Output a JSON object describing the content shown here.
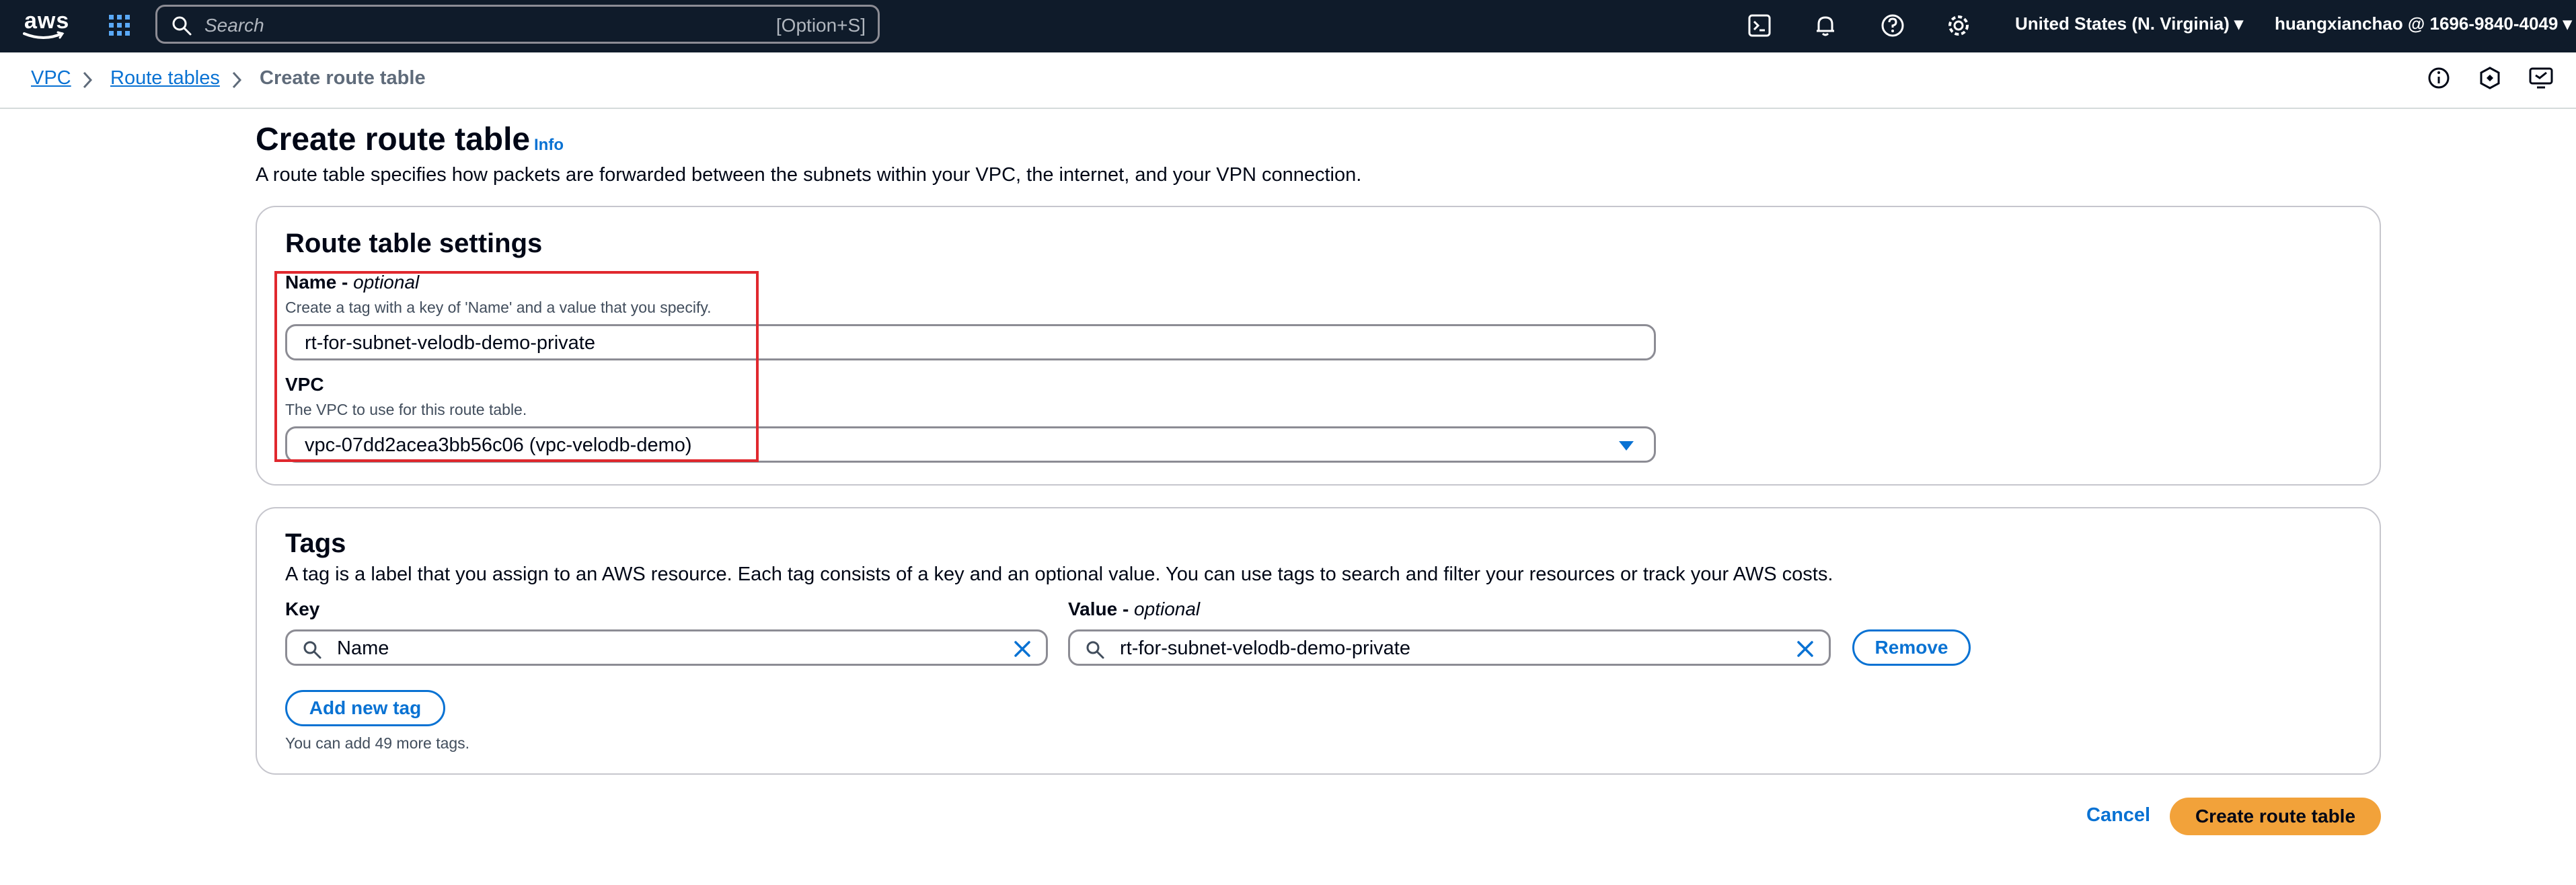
{
  "topnav": {
    "logo_text": "aws",
    "search_placeholder": "Search",
    "search_shortcut": "[Option+S]",
    "region": "United States (N. Virginia)",
    "account": "huangxianchao @ 1696-9840-4049"
  },
  "breadcrumb": {
    "items": [
      "VPC",
      "Route tables",
      "Create route table"
    ]
  },
  "header": {
    "title": "Create route table",
    "info": "Info",
    "description": "A route table specifies how packets are forwarded between the subnets within your VPC, the internet, and your VPN connection."
  },
  "settings": {
    "title": "Route table settings",
    "name_label": "Name - ",
    "name_optional": "optional",
    "name_hint": "Create a tag with a key of 'Name' and a value that you specify.",
    "name_value": "rt-for-subnet-velodb-demo-private",
    "vpc_label": "VPC",
    "vpc_hint": "The VPC to use for this route table.",
    "vpc_value": "vpc-07dd2acea3bb56c06 (vpc-velodb-demo)"
  },
  "tags": {
    "title": "Tags",
    "description": "A tag is a label that you assign to an AWS resource. Each tag consists of a key and an optional value. You can use tags to search and filter your resources or track your AWS costs.",
    "key_label": "Key",
    "value_label": "Value - ",
    "value_optional": "optional",
    "key_value": "Name",
    "value_value": "rt-for-subnet-velodb-demo-private",
    "remove_label": "Remove",
    "add_label": "Add new tag",
    "remaining_note": "You can add 49 more tags."
  },
  "footer": {
    "cancel_label": "Cancel",
    "create_label": "Create route table"
  },
  "colors": {
    "nav_bg": "#0f1b2a",
    "link": "#0972d3",
    "primary_button": "#f2a23a",
    "highlight_box": "#e0282e"
  },
  "icons": [
    "grid-icon",
    "search-icon",
    "cloudshell-icon",
    "bell-icon",
    "help-icon",
    "gear-icon",
    "info-circle-icon",
    "hexagon-icon",
    "feedback-icon",
    "caret-down-icon",
    "clear-icon",
    "chevron-right-icon"
  ]
}
